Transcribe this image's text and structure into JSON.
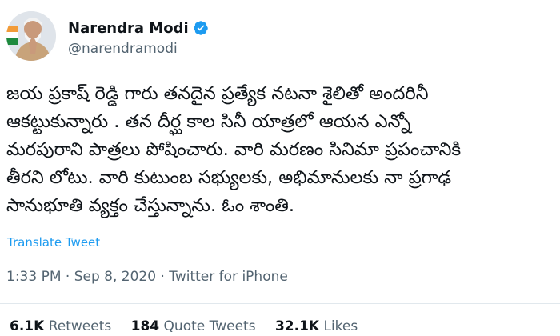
{
  "author": {
    "display_name": "Narendra Modi",
    "handle": "@narendramodi",
    "verified_icon": "verified-badge-icon"
  },
  "tweet": {
    "lines": [
      "జయ ప్రకాష్ రెడ్డి గారు తనదైన ప్రత్యేక నటనా శైలితో  అందరినీ",
      "ఆకట్టుకున్నారు . తన దీర్ఘ కాల సినీ యాత్రలో ఆయన ఎన్నో",
      "మరపురాని పాత్రలు పోషించారు. వారి మరణం  సినిమా ప్రపంచానికి",
      "తీరని  లోటు. వారి కుటుంబ సభ్యులకు, అభిమానులకు నా ప్రగాఢ",
      "సానుభూతి వ్యక్తం చేస్తున్నాను. ఓం శాంతి."
    ],
    "translate_label": "Translate Tweet",
    "time": "1:33 PM",
    "separator": "·",
    "date": "Sep 8, 2020",
    "source": "Twitter for iPhone"
  },
  "stats": {
    "retweets_count": "6.1K",
    "retweets_label": "Retweets",
    "quotes_count": "184",
    "quotes_label": "Quote Tweets",
    "likes_count": "32.1K",
    "likes_label": "Likes"
  },
  "colors": {
    "link_blue": "#1d9bf0",
    "secondary_text": "#536471",
    "primary_text": "#0f1419"
  }
}
